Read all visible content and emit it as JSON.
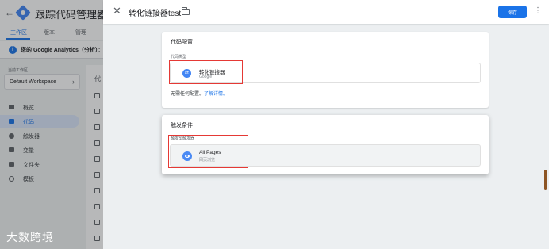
{
  "app": {
    "title": "跟踪代码管理器",
    "tabs": [
      {
        "label": "工作区",
        "active": true
      },
      {
        "label": "版本",
        "active": false
      },
      {
        "label": "管理",
        "active": false
      }
    ],
    "notice": "您的 Google Analytics（分析）：",
    "workspace": {
      "label": "当前工作区",
      "value": "Default Workspace"
    },
    "nav": [
      {
        "label": "概览",
        "icon": "briefcase-icon"
      },
      {
        "label": "代码",
        "icon": "tag-icon",
        "active": true
      },
      {
        "label": "触发器",
        "icon": "trigger-icon"
      },
      {
        "label": "变量",
        "icon": "variables-icon"
      },
      {
        "label": "文件夹",
        "icon": "folder-icon"
      },
      {
        "label": "模板",
        "icon": "template-icon"
      }
    ],
    "list_header": "代"
  },
  "panel": {
    "title": "转化链接器test",
    "save_label": "保存",
    "tag_config": {
      "section_title": "代码配置",
      "type_label": "代码类型",
      "type_name": "转化链接器",
      "type_vendor": "Google",
      "no_config_text": "无需任何配置。",
      "learn_more": "了解详情。"
    },
    "triggering": {
      "section_title": "触发条件",
      "trigger_label": "触发型触发器",
      "trigger_name": "All Pages",
      "trigger_sub": "网页浏览"
    }
  },
  "watermark": "大数跨境",
  "colors": {
    "accent": "#1a73e8",
    "highlight": "#e53935"
  }
}
